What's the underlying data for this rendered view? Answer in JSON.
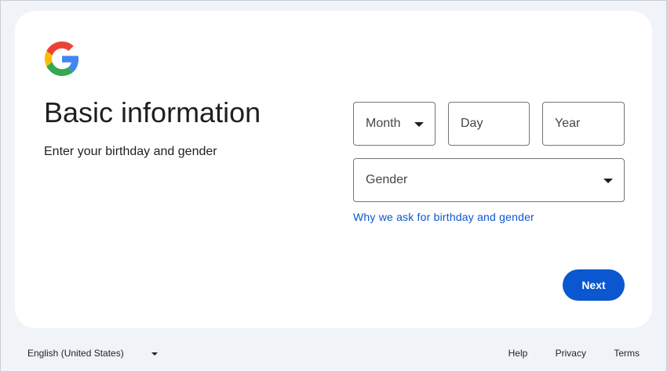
{
  "header": {
    "logo_icon": "google-g-logo-icon",
    "title": "Basic information",
    "subtitle": "Enter your birthday and gender"
  },
  "birthday": {
    "month_placeholder": "Month",
    "day_placeholder": "Day",
    "year_placeholder": "Year"
  },
  "gender": {
    "placeholder": "Gender"
  },
  "why_link": "Why we ask for birthday and gender",
  "next_button": "Next",
  "footer": {
    "language": "English (United States)",
    "help": "Help",
    "privacy": "Privacy",
    "terms": "Terms"
  },
  "colors": {
    "background": "#f0f4f9",
    "card": "#ffffff",
    "primary": "#0b57d0",
    "border": "#747775",
    "text": "#1f1f1f"
  }
}
